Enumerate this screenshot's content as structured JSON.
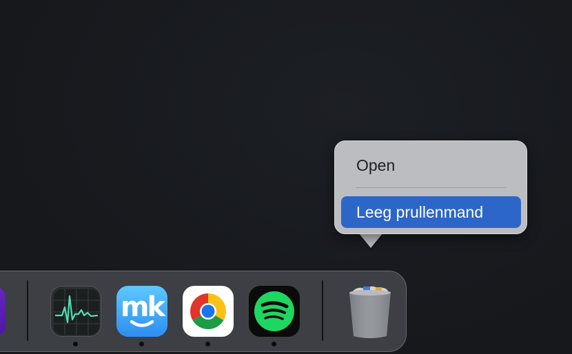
{
  "context_menu": {
    "items": [
      {
        "label": "Open"
      },
      {
        "label": "Leeg prullenmand",
        "highlighted": true
      }
    ]
  },
  "dock": {
    "apps": [
      {
        "icon": "purple-app-icon",
        "partial": true
      },
      {
        "icon": "activity-monitor-icon",
        "running": true
      },
      {
        "icon": "mackeeper-icon",
        "running": true,
        "logo_text": "mk"
      },
      {
        "icon": "chrome-icon",
        "running": true
      },
      {
        "icon": "spotify-icon",
        "running": true
      },
      {
        "icon": "trash-icon",
        "running": false
      }
    ]
  },
  "colors": {
    "highlight": "#2c66c9",
    "menu_bg": "#bcbdc0",
    "desktop_bg": "#17191d",
    "spotify_green": "#1ed760"
  }
}
